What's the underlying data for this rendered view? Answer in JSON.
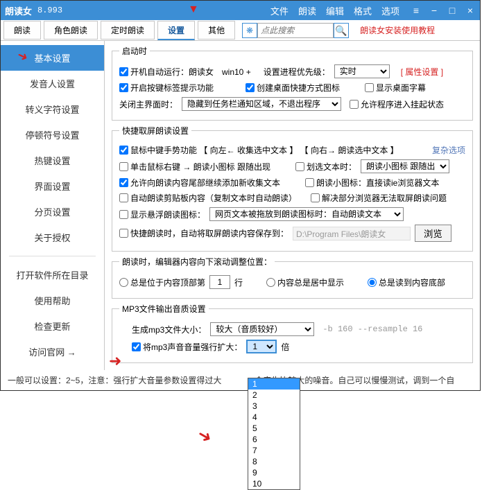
{
  "titlebar": {
    "title": "朗读女",
    "version": "8.993"
  },
  "menubar": {
    "file": "文件",
    "read": "朗读",
    "edit": "编辑",
    "format": "格式",
    "options": "选项"
  },
  "tabs": {
    "t0": "朗读",
    "t1": "角色朗读",
    "t2": "定时朗读",
    "t3": "设置",
    "t4": "其他"
  },
  "search": {
    "placeholder": "点此搜索"
  },
  "helplink": "朗读女安装使用教程",
  "sidebar": {
    "basic": "基本设置",
    "voice": "发音人设置",
    "font": "转义字符设置",
    "pause": "停顿符号设置",
    "hotkey": "热键设置",
    "ui": "界面设置",
    "page": "分页设置",
    "about": "关于授权",
    "open": "打开软件所在目录",
    "help": "使用帮助",
    "update": "检查更新",
    "site": "访问官网 →"
  },
  "sec1": {
    "legend": "启动时",
    "autorun": "开机自动运行：朗读女　win10 +",
    "priolabel": "设置进程优先级：",
    "priosel": "实时",
    "attr": "[ 属性设置 ]",
    "tip": "开启按键标签提示功能",
    "desk": "创建桌面快捷方式图标",
    "subtitle": "显示桌面字幕",
    "closelabel": "关闭主界面时：",
    "closesel": "隐藏到任务栏通知区域，不退出程序",
    "hang": "允许程序进入挂起状态"
  },
  "sec2": {
    "legend": "快捷取屏朗读设置",
    "middle": "鼠标中键手势功能 【 向左← 收集选中文本 】 【 向右→ 朗读选中文本 】",
    "complex": "复杂选项",
    "rclick": "单击鼠标右键 → 朗读小图标 跟随出现",
    "selecttext": "划选文本时：",
    "selectsel": "朗读小图标 跟随出现",
    "append": "允许向朗读内容尾部继续添加新收集文本",
    "smalllabel": "朗读小图标：直接读ie浏览器文本",
    "clip": "自动朗读剪贴板内容（复制文本时自动朗读）",
    "browser": "解决部分浏览器无法取屏朗读问题",
    "hover": "显示悬浮朗读图标：",
    "hoversel": "网页文本被拖放到朗读图标时：自动朗读文本",
    "fast": "快捷朗读时，自动将取屏朗读内容保存到：",
    "path": "D:\\Program Files\\朗读女\\TTSini",
    "browse": "浏览"
  },
  "sec3": {
    "legend": "朗读时，编辑器内容向下滚动调整位置：",
    "opt1": "总是位于内容顶部第",
    "opt1num": "1",
    "opt1suffix": "行",
    "opt2": "内容总是居中显示",
    "opt3": "总是读到内容底部"
  },
  "sec4": {
    "legend": "MP3文件输出音质设置",
    "sizelabel": "生成mp3文件大小：",
    "sizesel": "较大（音质较好）",
    "cmd": "-b 160 --resample 16",
    "amp": "将mp3声音音量强行扩大：",
    "ampval": "1",
    "ampsuffix": "倍"
  },
  "dropdown": {
    "opts": [
      "1",
      "2",
      "3",
      "4",
      "5",
      "6",
      "7",
      "8",
      "9",
      "10"
    ]
  },
  "footer": "一般可以设置：2~5，注意：强行扩大音量参数设置得过大　　　　会产生比较大的噪音。自己可以慢慢测试，调到一个自"
}
